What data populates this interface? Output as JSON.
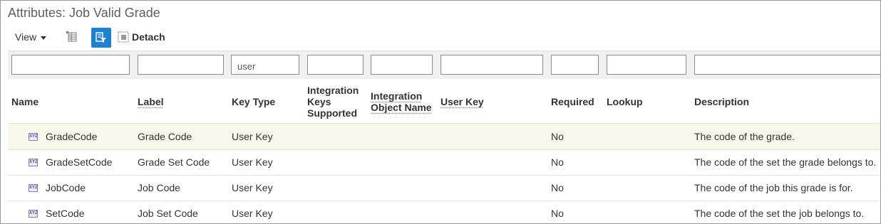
{
  "title": "Attributes: Job Valid Grade",
  "toolbar": {
    "view_label": "View",
    "detach_label": "Detach",
    "filter_active_color": "#1e81d2"
  },
  "filters": [
    "",
    "",
    "user",
    "",
    "",
    "",
    "",
    "",
    ""
  ],
  "columns": {
    "name": "Name",
    "label": "Label",
    "key_type": "Key Type",
    "integration_keys_line1": "Integration",
    "integration_keys_line2": "Keys",
    "integration_keys_line3": "Supported",
    "integration_object_line1": "Integration",
    "integration_object_line2": "Object Name",
    "user_key": "User Key",
    "required": "Required",
    "lookup": "Lookup",
    "description": "Description"
  },
  "rows": [
    {
      "name": "GradeCode",
      "label": "Grade Code",
      "key_type": "User Key",
      "required": "No",
      "description": "The code of the grade."
    },
    {
      "name": "GradeSetCode",
      "label": "Grade Set Code",
      "key_type": "User Key",
      "required": "No",
      "description": "The code of the set the grade belongs to."
    },
    {
      "name": "JobCode",
      "label": "Job Code",
      "key_type": "User Key",
      "required": "No",
      "description": "The code of the job this grade is for."
    },
    {
      "name": "SetCode",
      "label": "Job Set Code",
      "key_type": "User Key",
      "required": "No",
      "description": "The code of the set the job belongs to."
    }
  ],
  "icons": {
    "attribute": "xyz-attribute-icon",
    "xyz_text": "XYZ",
    "freeze": "freeze-columns-icon",
    "filter": "query-by-example-icon",
    "detach": "detach-icon"
  }
}
